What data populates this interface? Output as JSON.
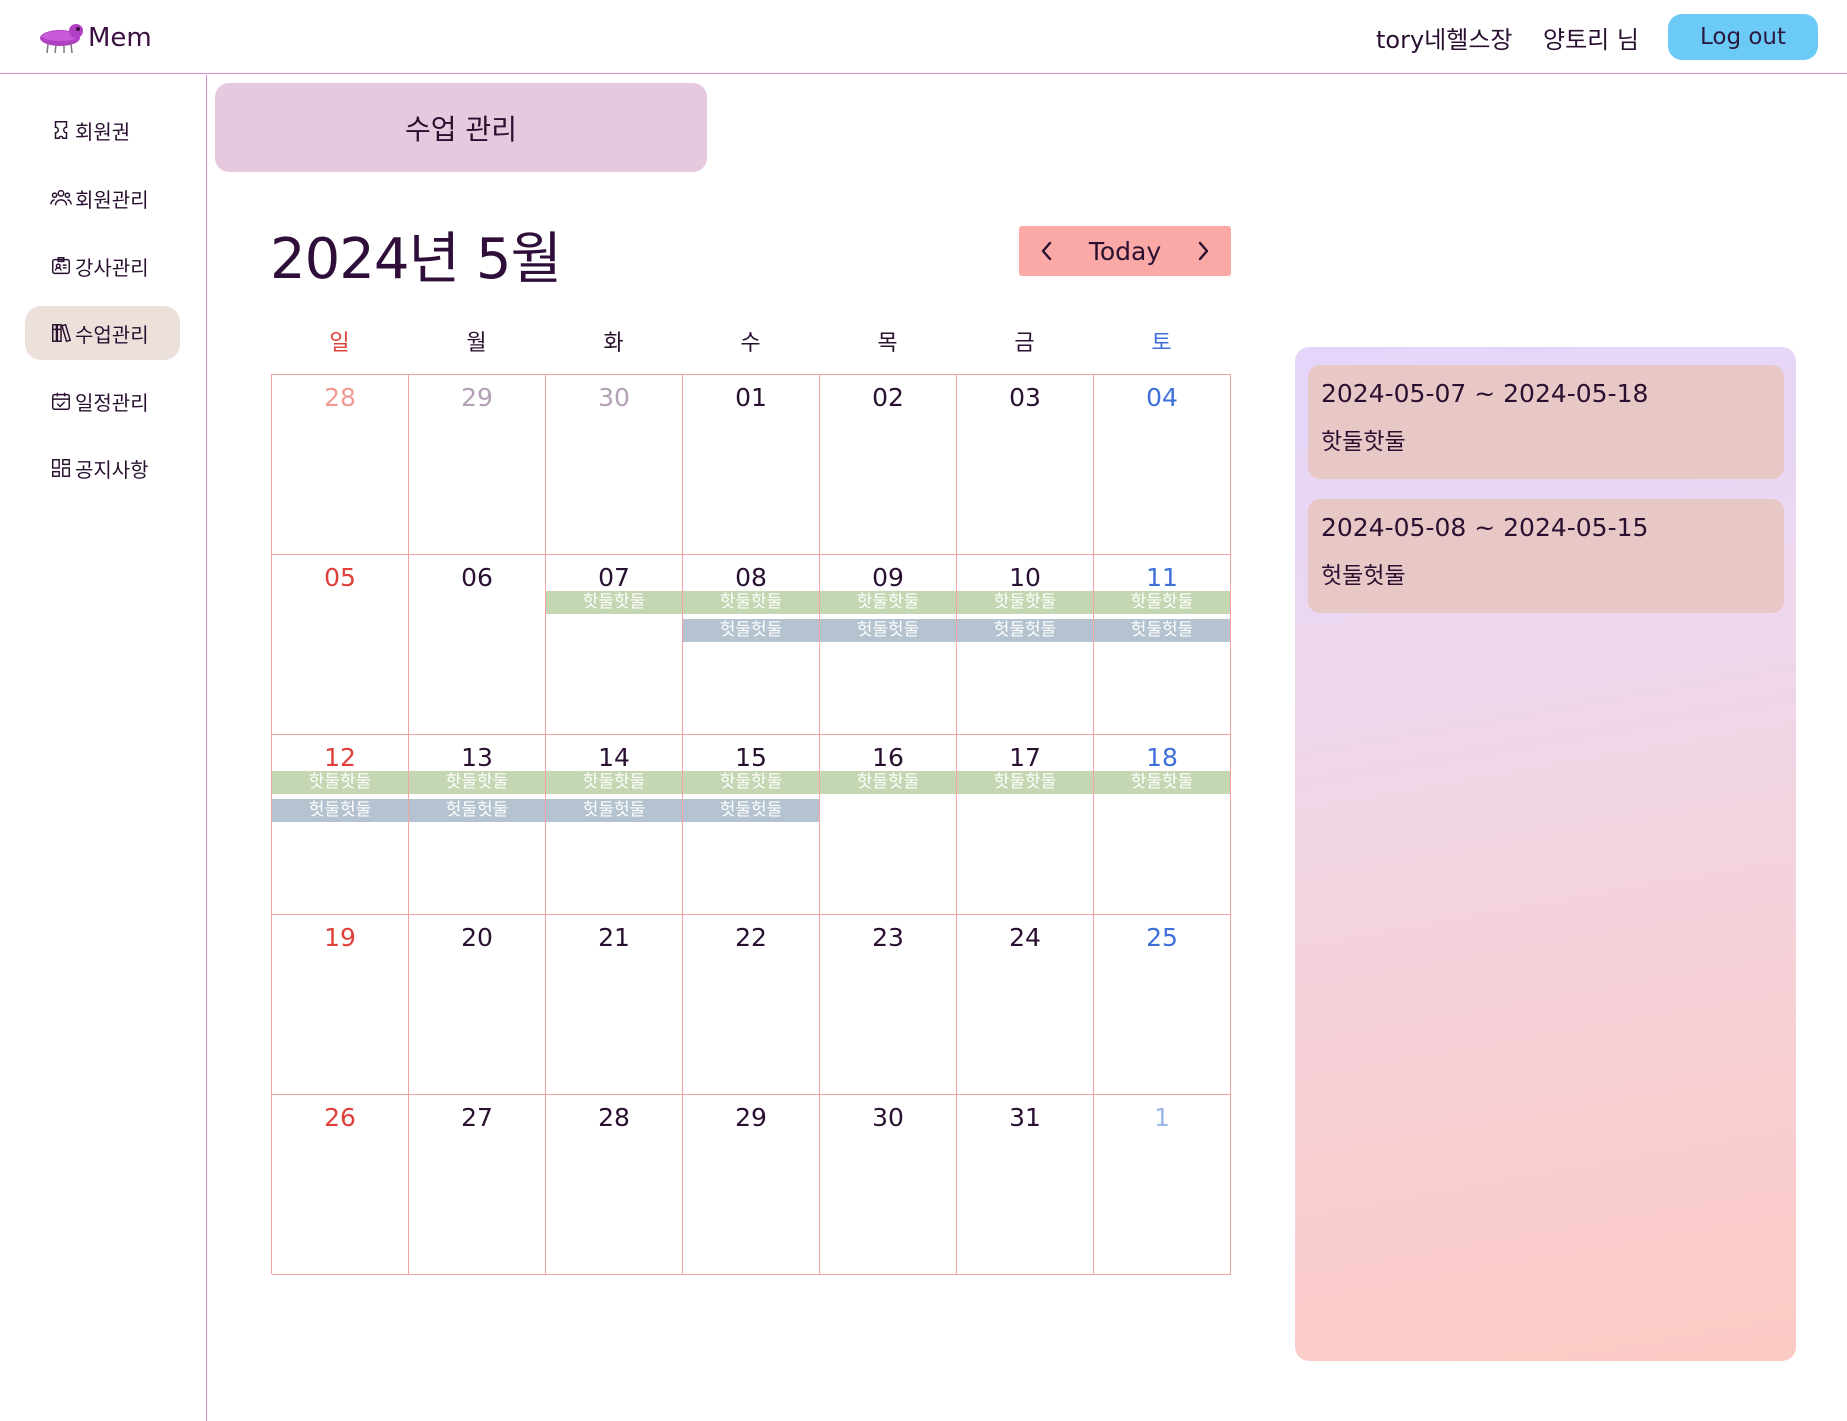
{
  "header": {
    "logo_text": "Mem",
    "gym_name": "tory네헬스장",
    "user_name": "양토리 님",
    "logout_label": "Log out"
  },
  "sidebar": {
    "items": [
      {
        "label": "회원권",
        "icon": "ticket-icon"
      },
      {
        "label": "회원관리",
        "icon": "users-icon"
      },
      {
        "label": "강사관리",
        "icon": "id-badge-icon"
      },
      {
        "label": "수업관리",
        "icon": "books-icon",
        "active": true
      },
      {
        "label": "일정관리",
        "icon": "calendar-check-icon"
      },
      {
        "label": "공지사항",
        "icon": "dashboard-icon"
      }
    ]
  },
  "page_tab": "수업 관리",
  "calendar": {
    "month_title": "2024년 5월",
    "nav": {
      "prev": "‹",
      "today": "Today",
      "next": "›"
    },
    "weekdays": [
      "일",
      "월",
      "화",
      "수",
      "목",
      "금",
      "토"
    ],
    "colors": {
      "sunday": "#e0403c",
      "saturday": "#3f6fd8",
      "other_month": "#b4a0b4",
      "other_month_sunday": "#f09a94",
      "other_month_saturday": "#9bb7ee",
      "grid": "#f3a4a0",
      "class_a": "#c4d7b2",
      "class_b": "#b4c3cf"
    },
    "weeks": [
      [
        {
          "day": "28",
          "other": true
        },
        {
          "day": "29",
          "other": true
        },
        {
          "day": "30",
          "other": true
        },
        {
          "day": "01"
        },
        {
          "day": "02"
        },
        {
          "day": "03"
        },
        {
          "day": "04"
        }
      ],
      [
        {
          "day": "05"
        },
        {
          "day": "06"
        },
        {
          "day": "07",
          "today": true,
          "events": [
            "핫둘핫둘"
          ]
        },
        {
          "day": "08",
          "events": [
            "핫둘핫둘",
            "헛둘헛둘"
          ]
        },
        {
          "day": "09",
          "events": [
            "핫둘핫둘",
            "헛둘헛둘"
          ]
        },
        {
          "day": "10",
          "events": [
            "핫둘핫둘",
            "헛둘헛둘"
          ]
        },
        {
          "day": "11",
          "events": [
            "핫둘핫둘",
            "헛둘헛둘"
          ]
        }
      ],
      [
        {
          "day": "12",
          "events": [
            "핫둘핫둘",
            "헛둘헛둘"
          ]
        },
        {
          "day": "13",
          "events": [
            "핫둘핫둘",
            "헛둘헛둘"
          ]
        },
        {
          "day": "14",
          "events": [
            "핫둘핫둘",
            "헛둘헛둘"
          ]
        },
        {
          "day": "15",
          "events": [
            "핫둘핫둘",
            "헛둘헛둘"
          ]
        },
        {
          "day": "16",
          "events": [
            "핫둘핫둘"
          ]
        },
        {
          "day": "17",
          "events": [
            "핫둘핫둘"
          ]
        },
        {
          "day": "18",
          "events": [
            "핫둘핫둘"
          ]
        }
      ],
      [
        {
          "day": "19"
        },
        {
          "day": "20"
        },
        {
          "day": "21"
        },
        {
          "day": "22"
        },
        {
          "day": "23"
        },
        {
          "day": "24"
        },
        {
          "day": "25"
        }
      ],
      [
        {
          "day": "26"
        },
        {
          "day": "27"
        },
        {
          "day": "28"
        },
        {
          "day": "29"
        },
        {
          "day": "30"
        },
        {
          "day": "31"
        },
        {
          "day": "1",
          "other": true
        }
      ]
    ]
  },
  "classes": [
    {
      "period": "2024-05-07 ~ 2024-05-18",
      "name": "핫둘핫둘"
    },
    {
      "period": "2024-05-08 ~ 2024-05-15",
      "name": "헛둘헛둘"
    }
  ]
}
